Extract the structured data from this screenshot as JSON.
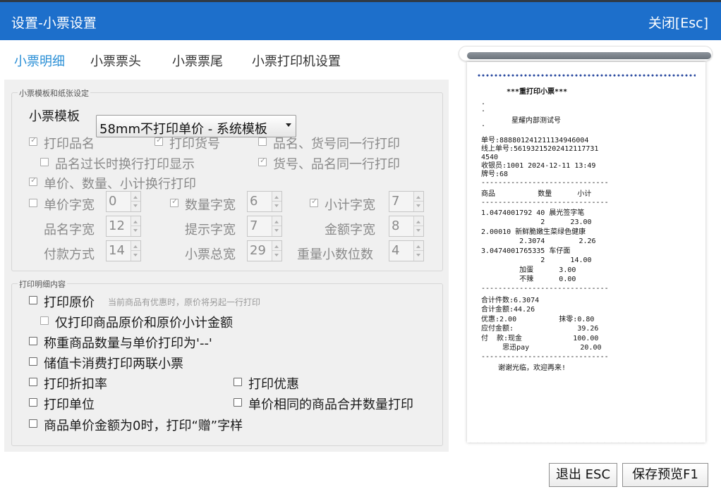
{
  "window": {
    "title": "设置-小票设置",
    "close_label": "关闭[Esc]"
  },
  "tabs": [
    {
      "label": "小票明细",
      "active": true
    },
    {
      "label": "小票票头",
      "active": false
    },
    {
      "label": "小票票尾",
      "active": false
    },
    {
      "label": "小票打印机设置",
      "active": false
    }
  ],
  "template_group": {
    "title": "小票模板和纸张设定",
    "template_label": "小票模板",
    "template_value": "58mm不打印单价 - 系统模板",
    "options": {
      "print_name": {
        "label": "打印品名",
        "checked": true
      },
      "print_code": {
        "label": "打印货号",
        "checked": true
      },
      "name_code_same_line": {
        "label": "品名、货号同一行打印",
        "checked": false
      },
      "name_wrap": {
        "label": "品名过长时换行打印显示",
        "checked": false
      },
      "code_name_same_line": {
        "label": "货号、品名同一行打印",
        "checked": true
      },
      "price_qty_subtotal_wrap": {
        "label": "单价、数量、小计换行打印",
        "checked": true
      },
      "price_width": {
        "label": "单价字宽",
        "checked": false,
        "value": "0"
      },
      "qty_width": {
        "label": "数量字宽",
        "checked": true,
        "value": "6"
      },
      "subtotal_width": {
        "label": "小计字宽",
        "checked": true,
        "value": "7"
      }
    },
    "fields": {
      "name_width": {
        "label": "品名字宽",
        "value": "12"
      },
      "hint_width": {
        "label": "提示字宽",
        "value": "7"
      },
      "amount_width": {
        "label": "金额字宽",
        "value": "8"
      },
      "payment_method": {
        "label": "付款方式",
        "value": "14"
      },
      "receipt_total_width": {
        "label": "小票总宽",
        "value": "29"
      },
      "weight_decimals": {
        "label": "重量小数位数",
        "value": "4"
      }
    }
  },
  "detail_group": {
    "title": "打印明细内容",
    "print_original_price": {
      "label": "打印原价",
      "checked": false,
      "hint": "当前商品有优惠时，原价将另起一行打印"
    },
    "only_original_price": {
      "label": "仅打印商品原价和原价小计金额",
      "checked": false
    },
    "weighing_dash": {
      "label": "称重商品数量与单价打印为'--'",
      "checked": false
    },
    "stored_value_two_copies": {
      "label": "储值卡消费打印两联小票",
      "checked": false
    },
    "print_discount_rate": {
      "label": "打印折扣率",
      "checked": false
    },
    "print_discount": {
      "label": "打印优惠",
      "checked": false
    },
    "print_unit": {
      "label": "打印单位",
      "checked": false
    },
    "merge_same_price": {
      "label": "单价相同的商品合并数量打印",
      "checked": false
    },
    "zero_price_gift": {
      "label": "商品单价金额为0时，打印“赠”字样",
      "checked": false
    }
  },
  "receipt": {
    "title": "***重打印小票***",
    "dots": [
      ".",
      ".",
      "."
    ],
    "store": "星耀内部测试号",
    "meta": [
      "单号:888801241211134946004",
      "线上单号:5619321520241211773​1",
      "4540",
      "收银员:1001 2024-12-11 13:49",
      "牌号:68"
    ],
    "sep": "------------------------------",
    "header": "商品          数量      小计",
    "items": [
      "1.0474001792 40 晨光签字笔",
      "              2      23.00",
      "2.00010 新鲜脆嫩生菜绿色健康",
      "         2.3074        2.26",
      "3.0474001765335 车仔面",
      "              2      14.00",
      "         加蛋      3.00",
      "         不辣      0.00"
    ],
    "totals": [
      "合计件数:6.3074",
      "合计金额:44.26",
      "优惠:2.00          抹零:0.80",
      "应付金额:               39.26",
      "付  款:现金            100.00",
      "     思迅pay            20.00"
    ],
    "thanks": "谢谢光临，欢迎再来!"
  },
  "buttons": {
    "exit": "退出 ESC",
    "save_preview": "保存预览F1"
  }
}
